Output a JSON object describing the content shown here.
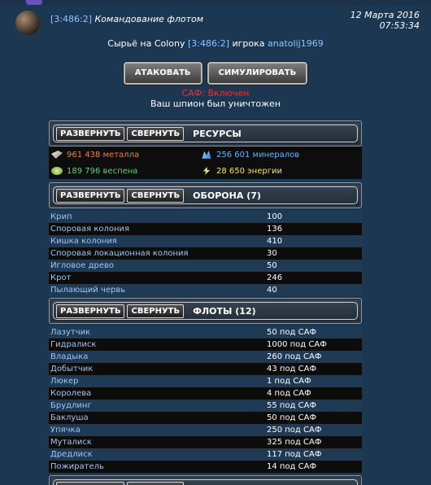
{
  "message": {
    "coords": "[3:486:2]",
    "subject": "Командование флотом",
    "date": "12 Марта 2016",
    "time": "07:53:34"
  },
  "report": {
    "prefix": "Сырьё на Colony",
    "coords": "[3:486:2]",
    "player_prefix": "игрока",
    "player": "anatolij1969"
  },
  "actions": {
    "attack": "АТАКОВАТЬ",
    "simulate": "СИМУЛИРОВАТЬ"
  },
  "status": {
    "saf": "САФ: Включен",
    "spy": "Ваш шпион был уничтожен"
  },
  "buttons": {
    "expand": "РАЗВЕРНУТЬ",
    "collapse": "СВЕРНУТЬ"
  },
  "resources": {
    "title": "РЕСУРСЫ",
    "metal": "961 438 металла",
    "minerals": "256 601 минералов",
    "vespene": "189 796 веспена",
    "energy": "28 650 энергии",
    "colors": {
      "metal": "#e8833a",
      "minerals": "#67b3ff",
      "vespene": "#5ed06b",
      "energy": "#f5e64a"
    }
  },
  "defense": {
    "title": "ОБОРОНА (7)",
    "rows": [
      {
        "name": "Крип",
        "value": "100"
      },
      {
        "name": "Споровая колония",
        "value": "136"
      },
      {
        "name": "Кишка колония",
        "value": "410"
      },
      {
        "name": "Споровая локационная колония",
        "value": "30"
      },
      {
        "name": "Игловое древо",
        "value": "50"
      },
      {
        "name": "Крот",
        "value": "246"
      },
      {
        "name": "Пылающий червь",
        "value": "40"
      }
    ]
  },
  "fleets": {
    "title": "ФЛОТЫ (12)",
    "rows": [
      {
        "name": "Лазутчик",
        "value": "50 под САФ"
      },
      {
        "name": "Гидралиск",
        "value": "1000 под САФ"
      },
      {
        "name": "Владыка",
        "value": "260 под САФ"
      },
      {
        "name": "Добытчик",
        "value": "43 под САФ"
      },
      {
        "name": "Люкер",
        "value": "1 под САФ"
      },
      {
        "name": "Королева",
        "value": "4 под САФ"
      },
      {
        "name": "Брудлинг",
        "value": "55 под САФ"
      },
      {
        "name": "Баклуша",
        "value": "50 под САФ"
      },
      {
        "name": "Упячка",
        "value": "250 под САФ"
      },
      {
        "name": "Муталиск",
        "value": "325 под САФ"
      },
      {
        "name": "Дредлиск",
        "value": "117 под САФ"
      },
      {
        "name": "Пожиратель",
        "value": "14 под САФ"
      }
    ]
  }
}
